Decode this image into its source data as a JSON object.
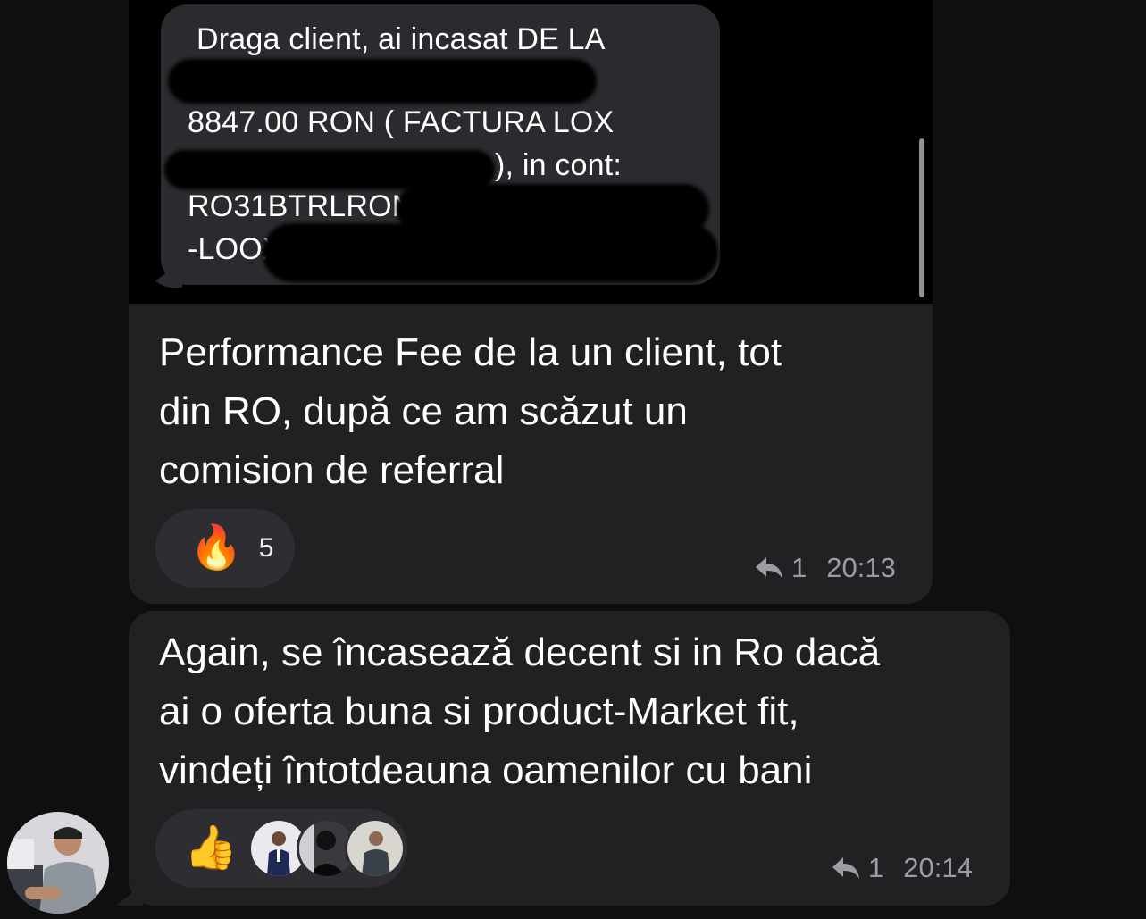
{
  "messages": [
    {
      "sms": {
        "line1": "Draga client, ai incasat DE LA",
        "line2": "8847.00 RON ( FACTURA LOX",
        "line3": "), in cont:",
        "line4": "RO31BTRLRONCR",
        "line5": "-LOOX"
      },
      "text_lines": [
        "Performance Fee de la un client, tot",
        "din RO, după ce am scăzut un",
        "comision de referral"
      ],
      "reaction": {
        "emoji": "🔥",
        "count": "5"
      },
      "reply_count": "1",
      "time": "20:13"
    },
    {
      "text_lines": [
        "Again, se încasează decent si in Ro dacă",
        "ai o oferta buna si product-Market fit,",
        "vindeți întotdeauna oamenilor cu bani"
      ],
      "reaction": {
        "emoji": "👍",
        "reactor_avatars": [
          "avatar-1",
          "avatar-2",
          "avatar-3"
        ]
      },
      "reply_count": "1",
      "time": "20:14"
    }
  ],
  "icons": {
    "reply": "reply-arrow-icon"
  },
  "colors": {
    "background": "#0f0f10",
    "bubble": "#212124",
    "reaction_pill": "#2e2e32",
    "meta_text": "#9c9ca3"
  }
}
